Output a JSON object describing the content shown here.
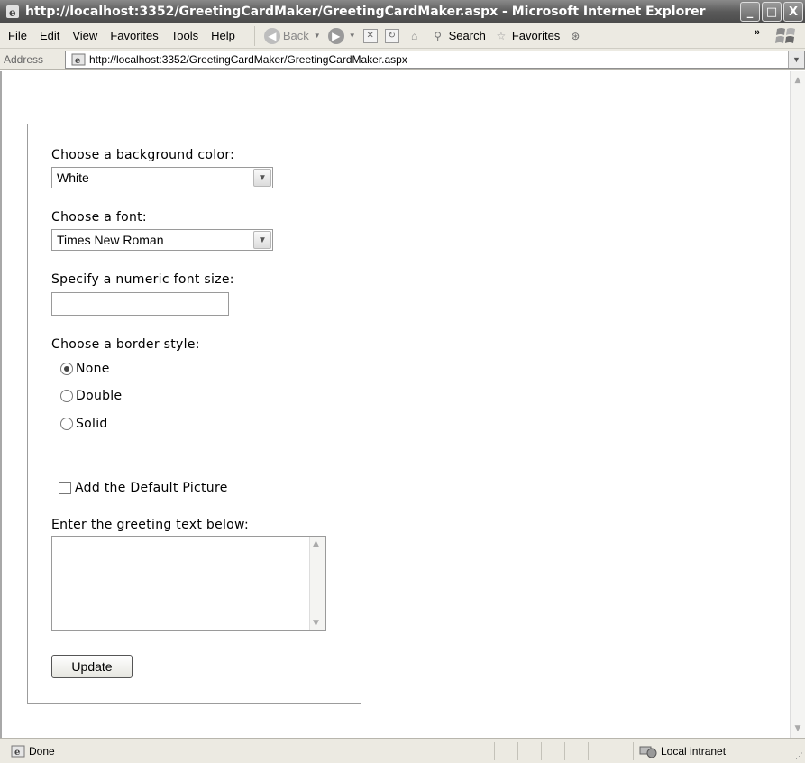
{
  "window": {
    "title": "http://localhost:3352/GreetingCardMaker/GreetingCardMaker.aspx - Microsoft Internet Explorer",
    "minimize": "_",
    "maximize": "□",
    "close": "X"
  },
  "menu": {
    "file": "File",
    "edit": "Edit",
    "view": "View",
    "favorites": "Favorites",
    "tools": "Tools",
    "help": "Help"
  },
  "toolbar": {
    "back": "Back",
    "search": "Search",
    "favorites": "Favorites",
    "more": "»"
  },
  "address": {
    "label": "Address",
    "url": "http://localhost:3352/GreetingCardMaker/GreetingCardMaker.aspx"
  },
  "form": {
    "bg_label": "Choose a background color:",
    "bg_value": "White",
    "font_label": "Choose a font:",
    "font_value": "Times New Roman",
    "size_label": "Specify a numeric font size:",
    "size_value": "",
    "border_label": "Choose a border style:",
    "border_options": [
      "None",
      "Double",
      "Solid"
    ],
    "border_selected": "None",
    "picture_label": "Add the Default Picture",
    "picture_checked": false,
    "greeting_label": "Enter the greeting text below:",
    "greeting_value": "",
    "update_label": "Update"
  },
  "status": {
    "text": "Done",
    "zone": "Local intranet"
  }
}
